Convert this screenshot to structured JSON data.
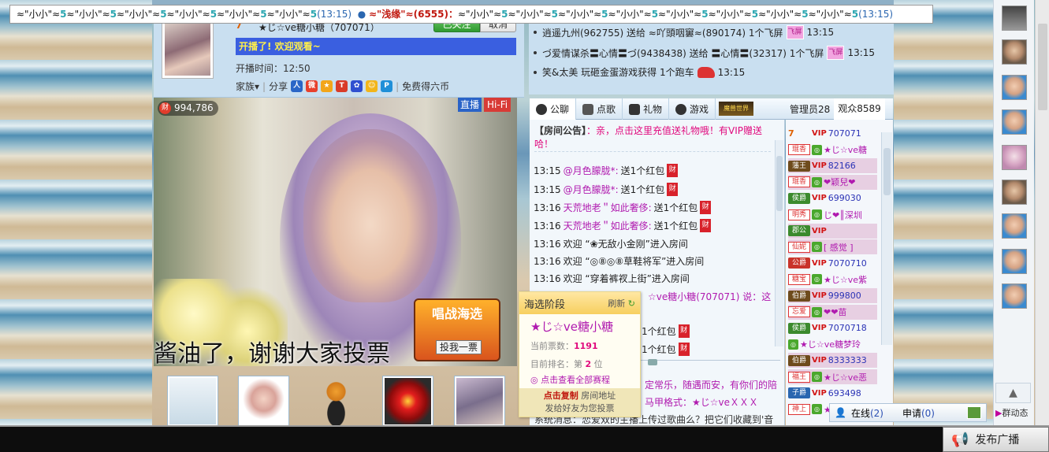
{
  "streamer": {
    "level": "7",
    "name": "★じ☆ve糖小糖（707071）",
    "follow_label": "已关注",
    "cancel_label": "取消",
    "motto": "开播了! 欢迎观看~",
    "start_time": "开播时间：12:50",
    "family_label": "家族▾",
    "share_label": "分享",
    "free_coins_label": "免费得六币"
  },
  "video": {
    "coins": "994,786",
    "live_label": "直播",
    "hifi_label": "Hi-Fi",
    "subtitle": "酱油了，谢谢大家投票",
    "vote_button": "投我一票",
    "battle_logo": "唱战海选"
  },
  "gift_feed": [
    {
      "text": "逍遥九州(962755) 送给 ≈吖頭咽窶≈(890174) 1个飞屏",
      "icon": "fly",
      "time": "13:15"
    },
    {
      "text": "づ爱情谋杀〓心情〓づ(9438438) 送给 〓心情〓(32317) 1个飞屏",
      "icon": "fly",
      "time": "13:15"
    },
    {
      "text": "笑&太美 玩砸金蛋游戏获得 1个跑车",
      "icon": "car",
      "time": "13:15"
    }
  ],
  "fly_icon_text": "飞屏",
  "tabs": [
    {
      "label": "公聊",
      "color": "#333"
    },
    {
      "label": "点歌",
      "color": "#444"
    },
    {
      "label": "礼物",
      "color": "#333"
    },
    {
      "label": "游戏",
      "color": "#333"
    }
  ],
  "magic_world": "魔兽世界",
  "userlist_tabs": {
    "admin": "管理员28",
    "audience": "观众8589"
  },
  "chat": {
    "notice_prefix": "【房间公告】",
    "notice_text": "：亲，点击这里充值送礼物哦！有VIP赠送哈！",
    "lines": [
      {
        "time": "13:15",
        "user": "@月色朦胧*:",
        "text": "送1个红包",
        "gift": true
      },
      {
        "time": "13:15",
        "user": "@月色朦胧*:",
        "text": "送1个红包",
        "gift": true
      },
      {
        "time": "13:16",
        "user": "天荒地老＂如此奢侈:",
        "text": "送1个红包",
        "gift": true
      },
      {
        "time": "13:16",
        "user": "天荒地老＂如此奢侈:",
        "text": "送1个红包",
        "gift": true
      },
      {
        "time": "13:16",
        "user": "",
        "text": "欢迎 “❀无敌小金刚”进入房间",
        "gift": false
      },
      {
        "time": "13:16",
        "user": "",
        "text": "欢迎 “◎⑧◎⑧草鞋将军”进入房间",
        "gift": false
      },
      {
        "time": "13:16",
        "user": "",
        "text": "欢迎 “穿着裤衩上街”进入房间",
        "gift": false
      }
    ],
    "partial_1": "☆ve糖小糖(707071) 说：这",
    "partial_2": "1个红包",
    "partial_3": "1个红包",
    "partial_4": "定常乐，随遇而安，有你们的陪",
    "partial_5": "马甲格式：★じ☆veＸＸＸ",
    "partial_6": "系统消息：恋爱双的主播上传过歌曲么？把它们收藏到'音"
  },
  "vote_popup": {
    "title": "海选阶段",
    "refresh": "刷新",
    "name": "★じ☆ve糖小糖",
    "votes_label": "当前票数：",
    "votes": "1191",
    "rank_label": "目前排名：第",
    "rank": "2",
    "rank_suffix": "位",
    "all_label": "◎ 点击查看全部赛程",
    "copy_label": "点击复制",
    "room_addr": "房间地址",
    "share_tip": "发给好友为您投票"
  },
  "userlist": [
    {
      "rank": "7",
      "rank_class": "lvl",
      "vip": "VIP",
      "name": "707071",
      "hl": false
    },
    {
      "rank": "琨香",
      "rank_class": "tag",
      "vip": "",
      "name": "★じ☆ve糖",
      "hl": false
    },
    {
      "rank": "藩王",
      "rank_class": "r-brown",
      "vip": "VIP",
      "name": "82166",
      "hl": true
    },
    {
      "rank": "琨香",
      "rank_class": "tag",
      "vip": "",
      "name": "❤颖兒❤",
      "hl": true
    },
    {
      "rank": "侯爵",
      "rank_class": "r-green",
      "vip": "VIP",
      "name": "699030",
      "hl": false
    },
    {
      "rank": "明秀",
      "rank_class": "tag",
      "vip": "",
      "name": "じ❤║深圳",
      "hl": false
    },
    {
      "rank": "郡公",
      "rank_class": "r-green",
      "vip": "VIP",
      "name": "",
      "hl": true
    },
    {
      "rank": "仙妮",
      "rank_class": "tag",
      "vip": "",
      "name": "[ 感觉 ]",
      "hl": true
    },
    {
      "rank": "公爵",
      "rank_class": "r-red",
      "vip": "VIP",
      "name": "7070710",
      "hl": false
    },
    {
      "rank": "糖宝",
      "rank_class": "tag",
      "vip": "",
      "name": "★じ☆ve紫",
      "hl": false
    },
    {
      "rank": "伯爵",
      "rank_class": "r-brown",
      "vip": "VIP",
      "name": "999800",
      "hl": true
    },
    {
      "rank": "忘爱",
      "rank_class": "tag",
      "vip": "",
      "name": "❤❤苗",
      "hl": true
    },
    {
      "rank": "侯爵",
      "rank_class": "r-green",
      "vip": "VIP",
      "name": "7070718",
      "hl": false
    },
    {
      "rank": "",
      "rank_class": "none",
      "vip": "",
      "name": "★じ☆ve糖梦玲",
      "hl": false
    },
    {
      "rank": "伯爵",
      "rank_class": "r-brown",
      "vip": "VIP",
      "name": "8333333",
      "hl": true
    },
    {
      "rank": "福王",
      "rank_class": "tag",
      "vip": "",
      "name": "★じ☆ve恶",
      "hl": true
    },
    {
      "rank": "子爵",
      "rank_class": "r-blue",
      "vip": "VIP",
      "name": "693498",
      "hl": false
    },
    {
      "rank": "神上",
      "rank_class": "tag",
      "vip": "",
      "name": "★じ☆ve",
      "hl": false
    }
  ],
  "online": {
    "label": "在线",
    "count": "(2)",
    "apply_label": "申请",
    "apply_count": "(0)"
  },
  "group_state": "群动态",
  "broadcast": {
    "text_a": "≈\"小小\"≈",
    "text_b": "≈\"小小\"≈",
    "time1": "(13:15)",
    "sender": "≈\"浅缘\"≈(6555)：",
    "time2": "(13:15)",
    "publish_label": "发布广播",
    "v": "5"
  }
}
